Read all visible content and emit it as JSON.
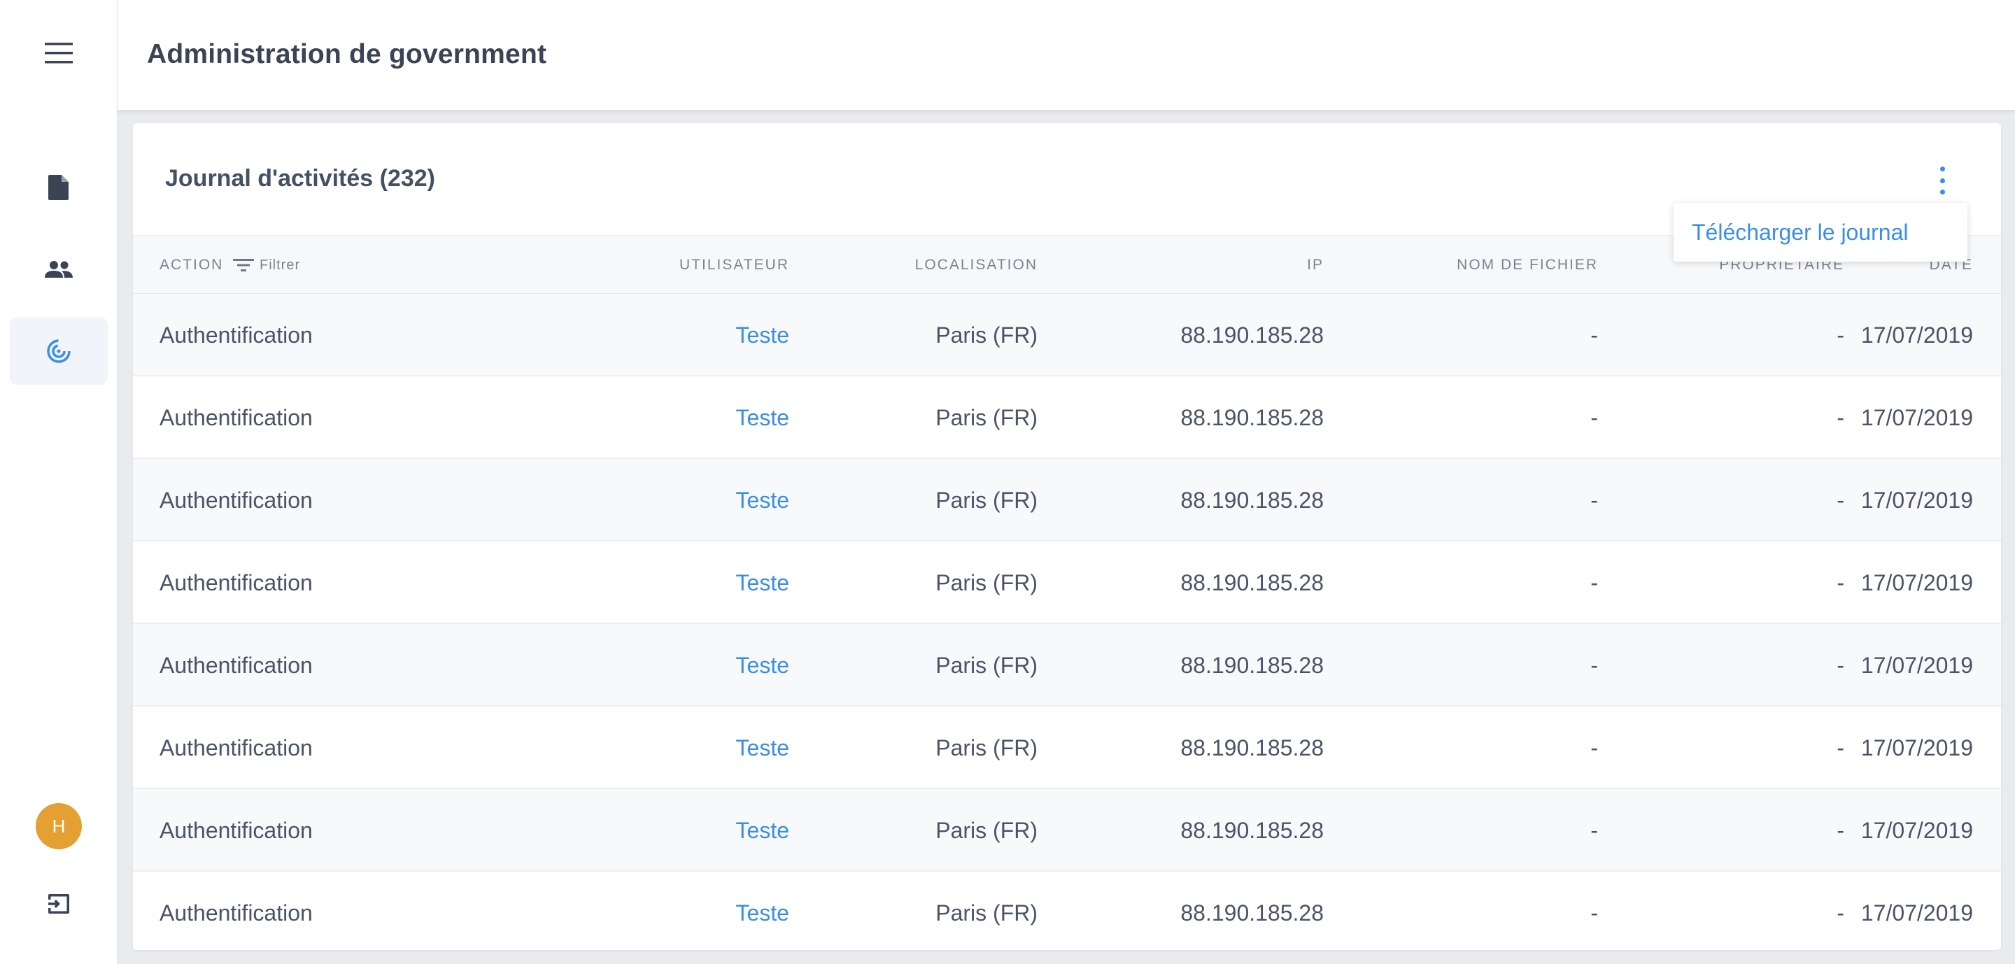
{
  "header": {
    "title": "Administration de government"
  },
  "sidebar": {
    "items": [
      {
        "name": "menu-icon"
      },
      {
        "name": "document-icon"
      },
      {
        "name": "users-icon"
      },
      {
        "name": "activity-icon",
        "active": true
      }
    ],
    "avatar_initial": "H",
    "logout_icon": "logout-icon"
  },
  "card": {
    "title": "Journal d'activités (232)",
    "menu_item": "Télécharger le journal"
  },
  "table": {
    "columns": {
      "action": "Action",
      "filter": "Filtrer",
      "user": "Utilisateur",
      "location": "Localisation",
      "ip": "IP",
      "filename": "Nom de fichier",
      "owner": "Propriétaire",
      "date": "Date"
    },
    "rows": [
      {
        "action": "Authentification",
        "user": "Teste",
        "location": "Paris (FR)",
        "ip": "88.190.185.28",
        "filename": "-",
        "owner": "-",
        "date": "17/07/2019"
      },
      {
        "action": "Authentification",
        "user": "Teste",
        "location": "Paris (FR)",
        "ip": "88.190.185.28",
        "filename": "-",
        "owner": "-",
        "date": "17/07/2019"
      },
      {
        "action": "Authentification",
        "user": "Teste",
        "location": "Paris (FR)",
        "ip": "88.190.185.28",
        "filename": "-",
        "owner": "-",
        "date": "17/07/2019"
      },
      {
        "action": "Authentification",
        "user": "Teste",
        "location": "Paris (FR)",
        "ip": "88.190.185.28",
        "filename": "-",
        "owner": "-",
        "date": "17/07/2019"
      },
      {
        "action": "Authentification",
        "user": "Teste",
        "location": "Paris (FR)",
        "ip": "88.190.185.28",
        "filename": "-",
        "owner": "-",
        "date": "17/07/2019"
      },
      {
        "action": "Authentification",
        "user": "Teste",
        "location": "Paris (FR)",
        "ip": "88.190.185.28",
        "filename": "-",
        "owner": "-",
        "date": "17/07/2019"
      },
      {
        "action": "Authentification",
        "user": "Teste",
        "location": "Paris (FR)",
        "ip": "88.190.185.28",
        "filename": "-",
        "owner": "-",
        "date": "17/07/2019"
      },
      {
        "action": "Authentification",
        "user": "Teste",
        "location": "Paris (FR)",
        "ip": "88.190.185.28",
        "filename": "-",
        "owner": "-",
        "date": "17/07/2019"
      }
    ]
  },
  "colors": {
    "accent": "#3a8ee6",
    "avatar": "#e5a033"
  }
}
